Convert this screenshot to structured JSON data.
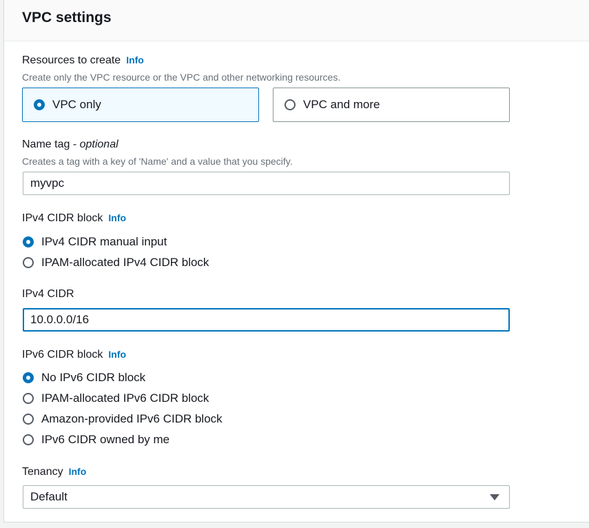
{
  "panel": {
    "title": "VPC settings"
  },
  "resources": {
    "label": "Resources to create",
    "info": "Info",
    "description": "Create only the VPC resource or the VPC and other networking resources.",
    "options": [
      {
        "label": "VPC only",
        "selected": true
      },
      {
        "label": "VPC and more",
        "selected": false
      }
    ]
  },
  "name_tag": {
    "label": "Name tag - ",
    "label_optional": "optional",
    "description": "Creates a tag with a key of 'Name' and a value that you specify.",
    "value": "myvpc"
  },
  "ipv4_block": {
    "label": "IPv4 CIDR block",
    "info": "Info",
    "options": [
      {
        "label": "IPv4 CIDR manual input",
        "selected": true
      },
      {
        "label": "IPAM-allocated IPv4 CIDR block",
        "selected": false
      }
    ]
  },
  "ipv4_cidr": {
    "label": "IPv4 CIDR",
    "value": "10.0.0.0/16"
  },
  "ipv6_block": {
    "label": "IPv6 CIDR block",
    "info": "Info",
    "options": [
      {
        "label": "No IPv6 CIDR block",
        "selected": true
      },
      {
        "label": "IPAM-allocated IPv6 CIDR block",
        "selected": false
      },
      {
        "label": "Amazon-provided IPv6 CIDR block",
        "selected": false
      },
      {
        "label": "IPv6 CIDR owned by me",
        "selected": false
      }
    ]
  },
  "tenancy": {
    "label": "Tenancy",
    "info": "Info",
    "value": "Default"
  },
  "colors": {
    "accent": "#0073bb",
    "selected_tile_bg": "#f1faff",
    "text": "#16191f",
    "muted": "#687078"
  }
}
